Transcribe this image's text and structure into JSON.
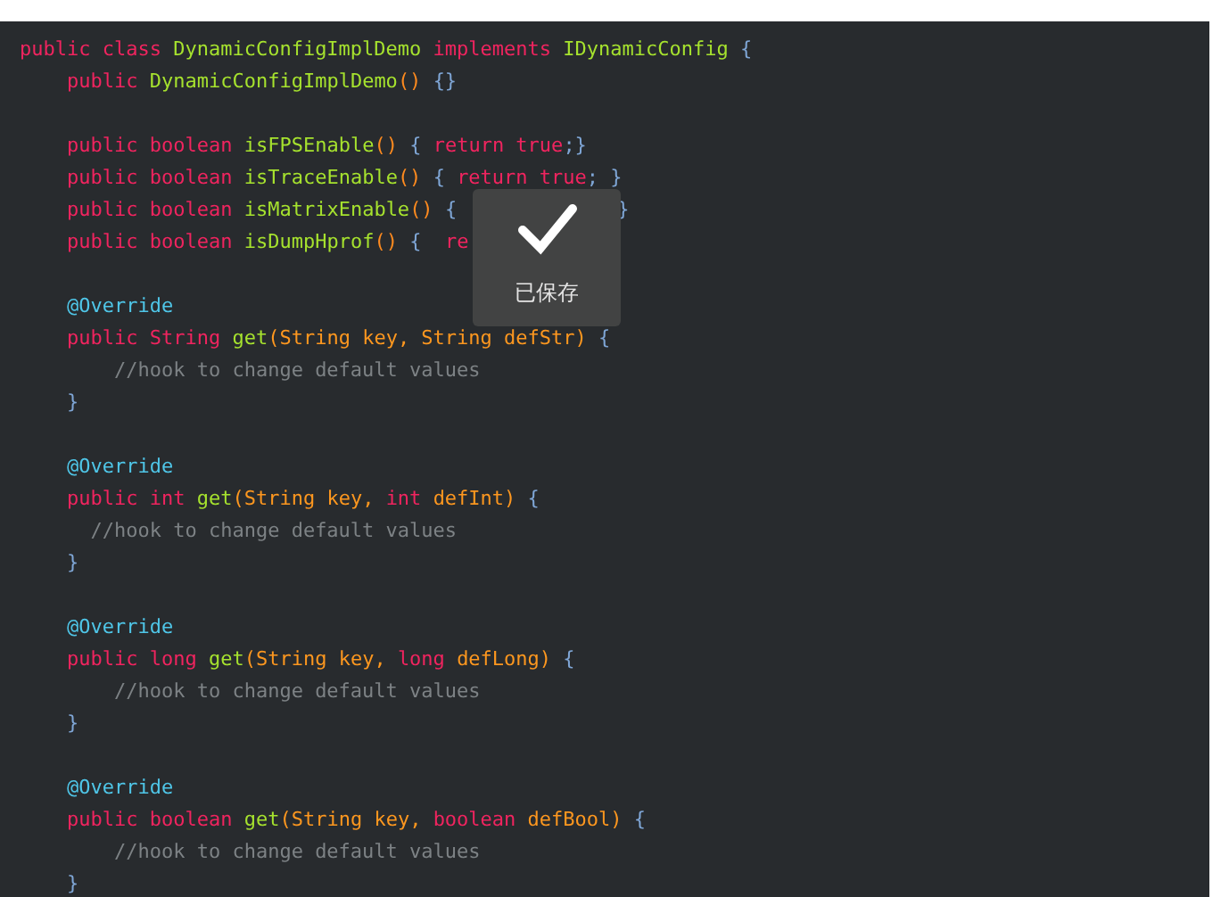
{
  "code_blocks": [
    {
      "lines": [
        {
          "tokens": [
            {
              "kind": "keyword",
              "text": "public class "
            },
            {
              "kind": "name",
              "text": "DynamicConfigImplDemo "
            },
            {
              "kind": "keyword",
              "text": "implements "
            },
            {
              "kind": "name",
              "text": "IDynamicConfig "
            },
            {
              "kind": "brace",
              "text": "{"
            }
          ]
        },
        {
          "tokens": [
            {
              "kind": "keyword",
              "text": "    public "
            },
            {
              "kind": "name",
              "text": "DynamicConfigImplDemo"
            },
            {
              "kind": "paren",
              "text": "() "
            },
            {
              "kind": "brace",
              "text": "{}"
            }
          ]
        }
      ]
    },
    {
      "lines": [
        {
          "tokens": [
            {
              "kind": "keyword",
              "text": "    public boolean "
            },
            {
              "kind": "name",
              "text": "isFPSEnable"
            },
            {
              "kind": "paren",
              "text": "() "
            },
            {
              "kind": "brace",
              "text": "{ "
            },
            {
              "kind": "keyword",
              "text": "return true"
            },
            {
              "kind": "brace",
              "text": ";}"
            }
          ]
        },
        {
          "tokens": [
            {
              "kind": "keyword",
              "text": "    public boolean "
            },
            {
              "kind": "name",
              "text": "isTraceEnable"
            },
            {
              "kind": "paren",
              "text": "() "
            },
            {
              "kind": "brace",
              "text": "{ "
            },
            {
              "kind": "keyword",
              "text": "return true"
            },
            {
              "kind": "brace",
              "text": "; }"
            }
          ]
        },
        {
          "tokens": [
            {
              "kind": "keyword",
              "text": "    public boolean "
            },
            {
              "kind": "name",
              "text": "isMatrixEnable"
            },
            {
              "kind": "paren",
              "text": "() "
            },
            {
              "kind": "brace",
              "text": "{"
            }
          ],
          "after_toast": [
            {
              "kind": "brace",
              "text": "}"
            }
          ]
        },
        {
          "tokens": [
            {
              "kind": "keyword",
              "text": "    public boolean "
            },
            {
              "kind": "name",
              "text": "isDumpHprof"
            },
            {
              "kind": "paren",
              "text": "() "
            },
            {
              "kind": "brace",
              "text": "{  "
            },
            {
              "kind": "keyword",
              "text": "re"
            }
          ]
        }
      ]
    },
    {
      "lines": [
        {
          "tokens": [
            {
              "kind": "annotation",
              "text": "    @Override"
            }
          ]
        },
        {
          "tokens": [
            {
              "kind": "keyword",
              "text": "    public String "
            },
            {
              "kind": "name",
              "text": "get"
            },
            {
              "kind": "param",
              "text": "(String key, String defStr) "
            },
            {
              "kind": "brace",
              "text": "{"
            }
          ]
        },
        {
          "tokens": [
            {
              "kind": "comment",
              "text": "        //hook to change default values"
            }
          ]
        },
        {
          "tokens": [
            {
              "kind": "brace",
              "text": "    }"
            }
          ]
        }
      ]
    },
    {
      "lines": [
        {
          "tokens": [
            {
              "kind": "annotation",
              "text": "    @Override"
            }
          ]
        },
        {
          "tokens": [
            {
              "kind": "keyword",
              "text": "    public int "
            },
            {
              "kind": "name",
              "text": "get"
            },
            {
              "kind": "param",
              "text": "(String key, "
            },
            {
              "kind": "keyword",
              "text": "int "
            },
            {
              "kind": "param",
              "text": "defInt) "
            },
            {
              "kind": "brace",
              "text": "{"
            }
          ]
        },
        {
          "tokens": [
            {
              "kind": "comment",
              "text": "      //hook to change default values"
            }
          ]
        },
        {
          "tokens": [
            {
              "kind": "brace",
              "text": "    }"
            }
          ]
        }
      ]
    },
    {
      "lines": [
        {
          "tokens": [
            {
              "kind": "annotation",
              "text": "    @Override"
            }
          ]
        },
        {
          "tokens": [
            {
              "kind": "keyword",
              "text": "    public long "
            },
            {
              "kind": "name",
              "text": "get"
            },
            {
              "kind": "param",
              "text": "(String key, "
            },
            {
              "kind": "keyword",
              "text": "long "
            },
            {
              "kind": "param",
              "text": "defLong) "
            },
            {
              "kind": "brace",
              "text": "{"
            }
          ]
        },
        {
          "tokens": [
            {
              "kind": "comment",
              "text": "        //hook to change default values"
            }
          ]
        },
        {
          "tokens": [
            {
              "kind": "brace",
              "text": "    }"
            }
          ]
        }
      ]
    },
    {
      "lines": [
        {
          "tokens": [
            {
              "kind": "annotation",
              "text": "    @Override"
            }
          ]
        },
        {
          "tokens": [
            {
              "kind": "keyword",
              "text": "    public boolean "
            },
            {
              "kind": "name",
              "text": "get"
            },
            {
              "kind": "param",
              "text": "(String key, "
            },
            {
              "kind": "keyword",
              "text": "boolean "
            },
            {
              "kind": "param",
              "text": "defBool) "
            },
            {
              "kind": "brace",
              "text": "{"
            }
          ]
        },
        {
          "tokens": [
            {
              "kind": "comment",
              "text": "        //hook to change default values"
            }
          ]
        },
        {
          "tokens": [
            {
              "kind": "brace",
              "text": "    }"
            }
          ]
        }
      ]
    }
  ],
  "toast": {
    "message": "已保存"
  }
}
